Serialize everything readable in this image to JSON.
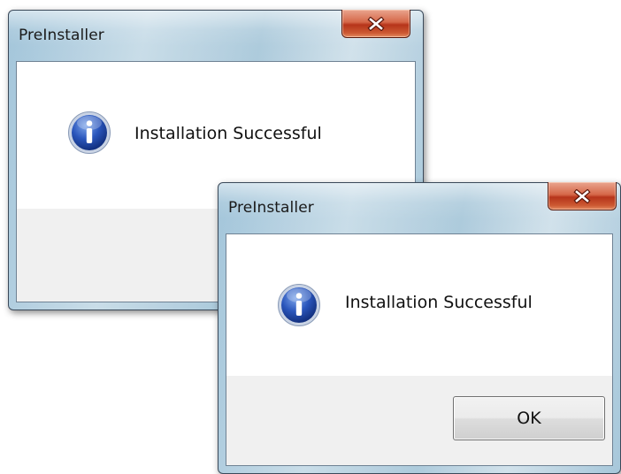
{
  "dialogs": [
    {
      "title": "PreInstaller",
      "message": "Installation Successful",
      "close_glyph": "x",
      "icon": "info-icon"
    },
    {
      "title": "PreInstaller",
      "message": "Installation Successful",
      "close_glyph": "x",
      "icon": "info-icon",
      "ok_label": "OK"
    }
  ],
  "colors": {
    "close_button": "#c94a2a",
    "info_icon": "#1f47a8",
    "button_area": "#f0f0f0"
  }
}
